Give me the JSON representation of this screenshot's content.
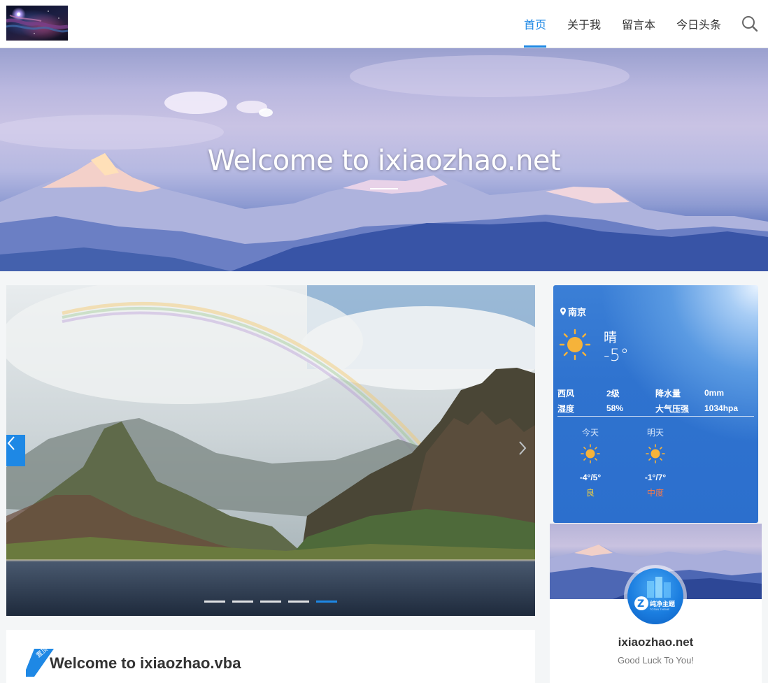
{
  "header": {
    "nav": [
      {
        "label": "首页",
        "active": true
      },
      {
        "label": "关于我",
        "active": false
      },
      {
        "label": "留言本",
        "active": false
      },
      {
        "label": "今日头条",
        "active": false
      }
    ],
    "search_icon": "search-icon",
    "accent_color": "#1e88e5"
  },
  "banner": {
    "title": "Welcome to ixiaozhao.net"
  },
  "slider": {
    "slide_count": 5,
    "active_slide": 5,
    "prev_icon": "chevron-left-icon",
    "next_icon": "chevron-right-icon"
  },
  "post": {
    "badge": "置顶",
    "title": "Welcome to ixiaozhao.vba"
  },
  "weather": {
    "city": "南京",
    "condition": "晴",
    "temperature": "-5°",
    "stats": [
      [
        "西风",
        "2级",
        "降水量",
        "0mm"
      ],
      [
        "湿度",
        "58%",
        "大气压强",
        "1034hpa"
      ]
    ],
    "forecast": [
      {
        "label": "今天",
        "temp": "-4°/5°",
        "aqi": "良",
        "aqi_color": "#f7d23a"
      },
      {
        "label": "明天",
        "temp": "-1°/7°",
        "aqi": "中度",
        "aqi_color": "#ff7a45"
      }
    ]
  },
  "profile": {
    "avatar_text": "纯净主题",
    "avatar_sub": "TOTAN THEME",
    "name": "ixiaozhao.net",
    "motto": "Good Luck To You!"
  }
}
